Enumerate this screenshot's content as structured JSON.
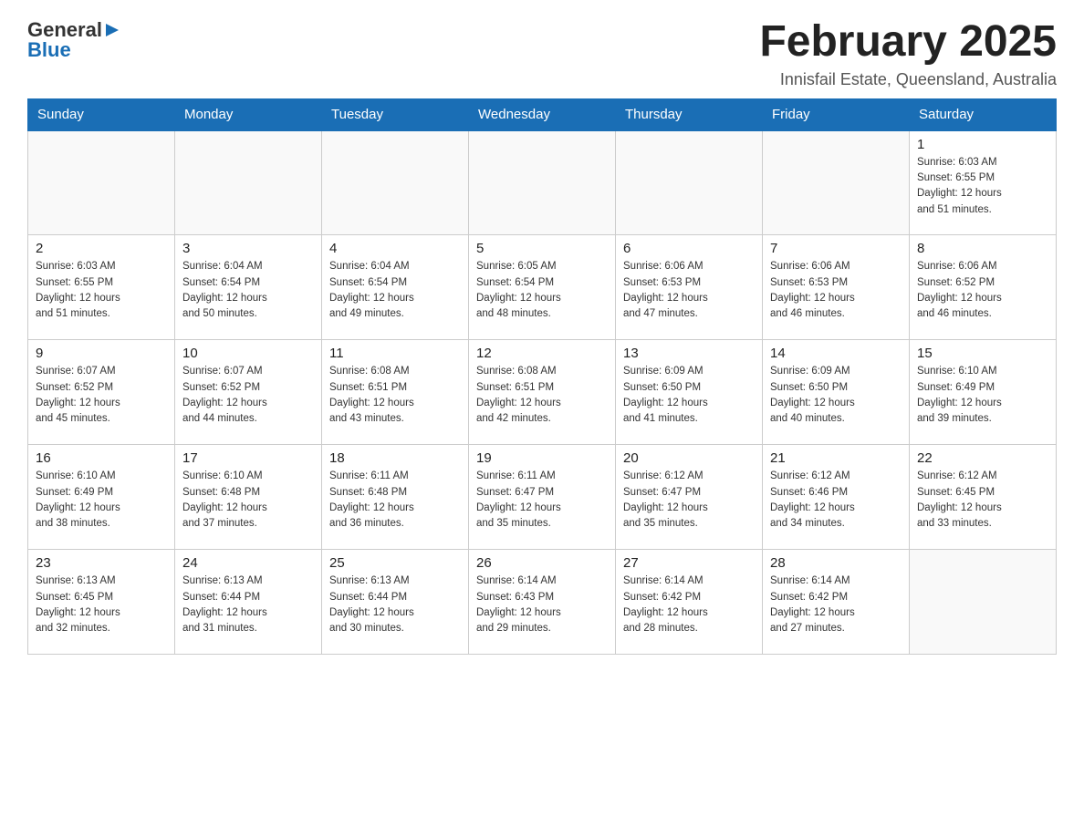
{
  "header": {
    "logo_general": "General",
    "logo_blue": "Blue",
    "month_title": "February 2025",
    "location": "Innisfail Estate, Queensland, Australia"
  },
  "days_of_week": [
    "Sunday",
    "Monday",
    "Tuesday",
    "Wednesday",
    "Thursday",
    "Friday",
    "Saturday"
  ],
  "weeks": [
    {
      "days": [
        {
          "number": "",
          "info": ""
        },
        {
          "number": "",
          "info": ""
        },
        {
          "number": "",
          "info": ""
        },
        {
          "number": "",
          "info": ""
        },
        {
          "number": "",
          "info": ""
        },
        {
          "number": "",
          "info": ""
        },
        {
          "number": "1",
          "info": "Sunrise: 6:03 AM\nSunset: 6:55 PM\nDaylight: 12 hours\nand 51 minutes."
        }
      ]
    },
    {
      "days": [
        {
          "number": "2",
          "info": "Sunrise: 6:03 AM\nSunset: 6:55 PM\nDaylight: 12 hours\nand 51 minutes."
        },
        {
          "number": "3",
          "info": "Sunrise: 6:04 AM\nSunset: 6:54 PM\nDaylight: 12 hours\nand 50 minutes."
        },
        {
          "number": "4",
          "info": "Sunrise: 6:04 AM\nSunset: 6:54 PM\nDaylight: 12 hours\nand 49 minutes."
        },
        {
          "number": "5",
          "info": "Sunrise: 6:05 AM\nSunset: 6:54 PM\nDaylight: 12 hours\nand 48 minutes."
        },
        {
          "number": "6",
          "info": "Sunrise: 6:06 AM\nSunset: 6:53 PM\nDaylight: 12 hours\nand 47 minutes."
        },
        {
          "number": "7",
          "info": "Sunrise: 6:06 AM\nSunset: 6:53 PM\nDaylight: 12 hours\nand 46 minutes."
        },
        {
          "number": "8",
          "info": "Sunrise: 6:06 AM\nSunset: 6:52 PM\nDaylight: 12 hours\nand 46 minutes."
        }
      ]
    },
    {
      "days": [
        {
          "number": "9",
          "info": "Sunrise: 6:07 AM\nSunset: 6:52 PM\nDaylight: 12 hours\nand 45 minutes."
        },
        {
          "number": "10",
          "info": "Sunrise: 6:07 AM\nSunset: 6:52 PM\nDaylight: 12 hours\nand 44 minutes."
        },
        {
          "number": "11",
          "info": "Sunrise: 6:08 AM\nSunset: 6:51 PM\nDaylight: 12 hours\nand 43 minutes."
        },
        {
          "number": "12",
          "info": "Sunrise: 6:08 AM\nSunset: 6:51 PM\nDaylight: 12 hours\nand 42 minutes."
        },
        {
          "number": "13",
          "info": "Sunrise: 6:09 AM\nSunset: 6:50 PM\nDaylight: 12 hours\nand 41 minutes."
        },
        {
          "number": "14",
          "info": "Sunrise: 6:09 AM\nSunset: 6:50 PM\nDaylight: 12 hours\nand 40 minutes."
        },
        {
          "number": "15",
          "info": "Sunrise: 6:10 AM\nSunset: 6:49 PM\nDaylight: 12 hours\nand 39 minutes."
        }
      ]
    },
    {
      "days": [
        {
          "number": "16",
          "info": "Sunrise: 6:10 AM\nSunset: 6:49 PM\nDaylight: 12 hours\nand 38 minutes."
        },
        {
          "number": "17",
          "info": "Sunrise: 6:10 AM\nSunset: 6:48 PM\nDaylight: 12 hours\nand 37 minutes."
        },
        {
          "number": "18",
          "info": "Sunrise: 6:11 AM\nSunset: 6:48 PM\nDaylight: 12 hours\nand 36 minutes."
        },
        {
          "number": "19",
          "info": "Sunrise: 6:11 AM\nSunset: 6:47 PM\nDaylight: 12 hours\nand 35 minutes."
        },
        {
          "number": "20",
          "info": "Sunrise: 6:12 AM\nSunset: 6:47 PM\nDaylight: 12 hours\nand 35 minutes."
        },
        {
          "number": "21",
          "info": "Sunrise: 6:12 AM\nSunset: 6:46 PM\nDaylight: 12 hours\nand 34 minutes."
        },
        {
          "number": "22",
          "info": "Sunrise: 6:12 AM\nSunset: 6:45 PM\nDaylight: 12 hours\nand 33 minutes."
        }
      ]
    },
    {
      "days": [
        {
          "number": "23",
          "info": "Sunrise: 6:13 AM\nSunset: 6:45 PM\nDaylight: 12 hours\nand 32 minutes."
        },
        {
          "number": "24",
          "info": "Sunrise: 6:13 AM\nSunset: 6:44 PM\nDaylight: 12 hours\nand 31 minutes."
        },
        {
          "number": "25",
          "info": "Sunrise: 6:13 AM\nSunset: 6:44 PM\nDaylight: 12 hours\nand 30 minutes."
        },
        {
          "number": "26",
          "info": "Sunrise: 6:14 AM\nSunset: 6:43 PM\nDaylight: 12 hours\nand 29 minutes."
        },
        {
          "number": "27",
          "info": "Sunrise: 6:14 AM\nSunset: 6:42 PM\nDaylight: 12 hours\nand 28 minutes."
        },
        {
          "number": "28",
          "info": "Sunrise: 6:14 AM\nSunset: 6:42 PM\nDaylight: 12 hours\nand 27 minutes."
        },
        {
          "number": "",
          "info": ""
        }
      ]
    }
  ]
}
